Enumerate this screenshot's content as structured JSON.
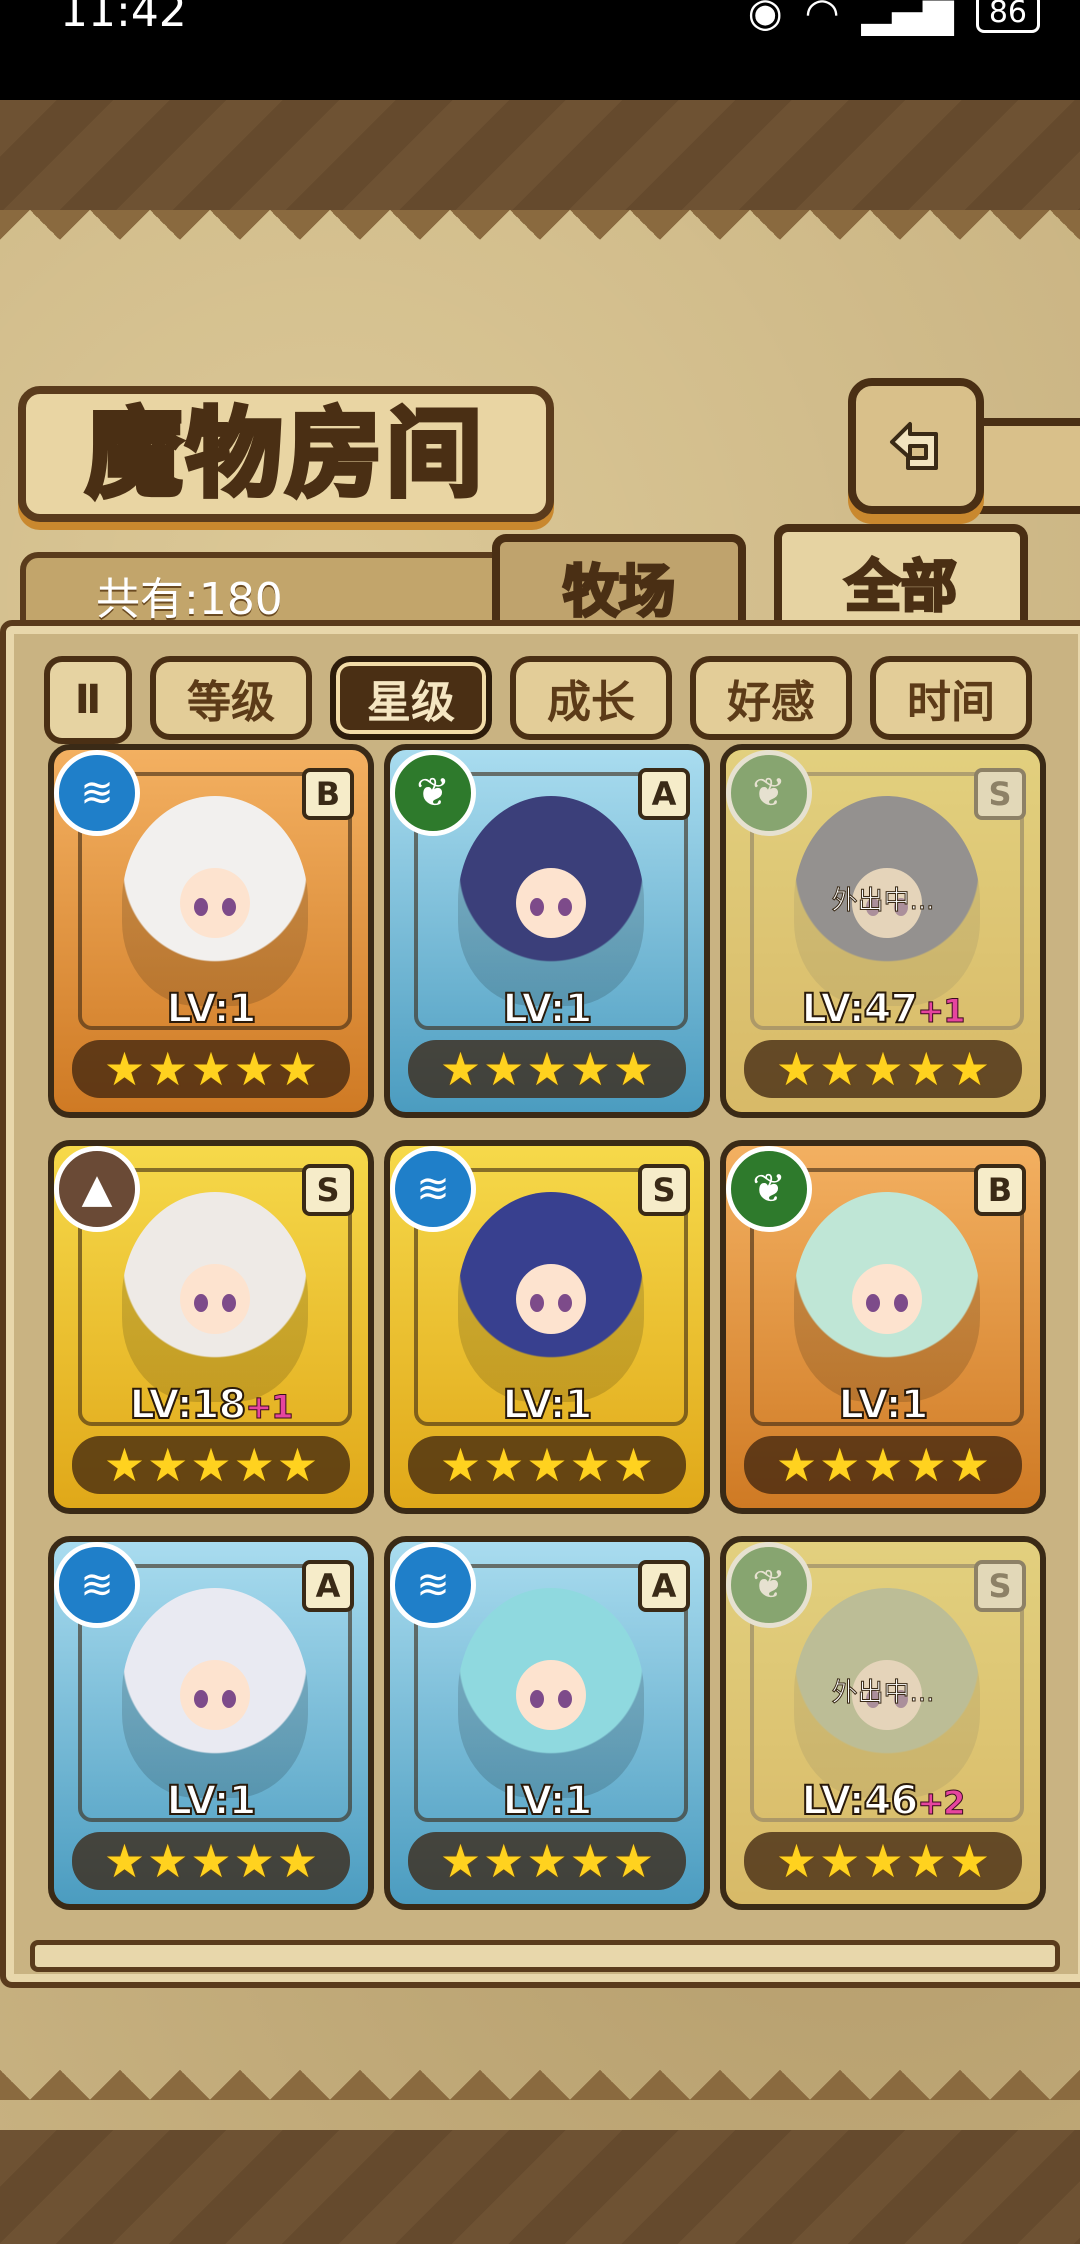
{
  "status_bar": {
    "time": "11:42",
    "battery": "86"
  },
  "header": {
    "title": "魔物房间"
  },
  "count": {
    "label": "共有:180"
  },
  "tabs": [
    {
      "label": "牧场"
    },
    {
      "label": "全部"
    }
  ],
  "filters": [
    {
      "label": "等级",
      "active": false
    },
    {
      "label": "星级",
      "active": true
    },
    {
      "label": "成长",
      "active": false
    },
    {
      "label": "好感",
      "active": false
    },
    {
      "label": "时间",
      "active": false
    }
  ],
  "sort_toggle": {
    "label": "Ⅱ"
  },
  "cards": [
    {
      "element": "water",
      "rank": "B",
      "level": "LV:1",
      "bonus": "",
      "frame": "bronze",
      "away": false,
      "stars": 5
    },
    {
      "element": "wood",
      "rank": "A",
      "level": "LV:1",
      "bonus": "",
      "frame": "blue",
      "away": false,
      "stars": 5
    },
    {
      "element": "wood",
      "rank": "S",
      "level": "LV:47",
      "bonus": "+1",
      "frame": "gold",
      "away": true,
      "away_text": "外出中...",
      "stars": 5
    },
    {
      "element": "earth",
      "rank": "S",
      "level": "LV:18",
      "bonus": "+1",
      "frame": "gold",
      "away": false,
      "stars": 5
    },
    {
      "element": "water",
      "rank": "S",
      "level": "LV:1",
      "bonus": "",
      "frame": "gold",
      "away": false,
      "stars": 5
    },
    {
      "element": "wood",
      "rank": "B",
      "level": "LV:1",
      "bonus": "",
      "frame": "bronze",
      "away": false,
      "stars": 5
    },
    {
      "element": "water",
      "rank": "A",
      "level": "LV:1",
      "bonus": "",
      "frame": "blue",
      "away": false,
      "stars": 5
    },
    {
      "element": "water",
      "rank": "A",
      "level": "LV:1",
      "bonus": "",
      "frame": "blue",
      "away": false,
      "stars": 5
    },
    {
      "element": "wood",
      "rank": "S",
      "level": "LV:46",
      "bonus": "+2",
      "frame": "gold",
      "away": true,
      "away_text": "外出中...",
      "stars": 5
    }
  ]
}
